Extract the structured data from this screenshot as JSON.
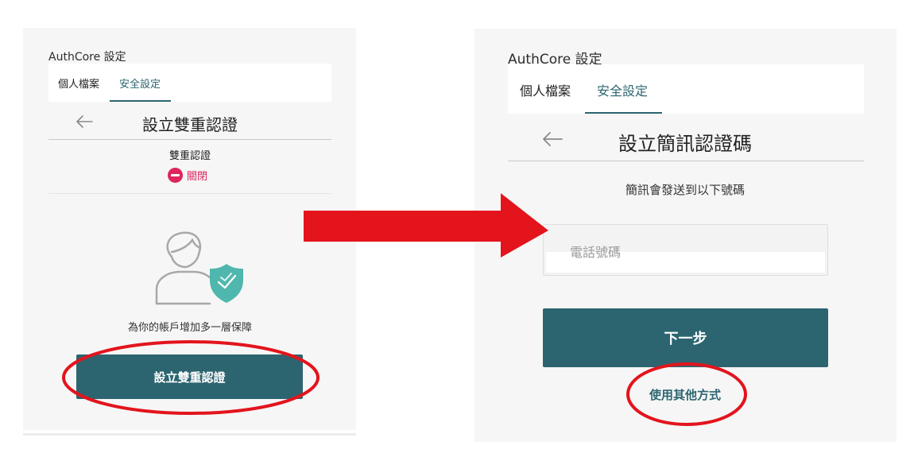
{
  "left": {
    "app_title": "AuthCore 設定",
    "tabs": [
      {
        "label": "個人檔案",
        "active": false
      },
      {
        "label": "安全設定",
        "active": true
      }
    ],
    "heading": "設立雙重認證",
    "twofa_label": "雙重認證",
    "status_text": "關閉",
    "status_color": "#e0245e",
    "tagline": "為你的帳戶增加多一層保障",
    "setup_button": "設立雙重認證"
  },
  "right": {
    "app_title": "AuthCore 設定",
    "tabs": [
      {
        "label": "個人檔案",
        "active": false
      },
      {
        "label": "安全設定",
        "active": true
      }
    ],
    "heading": "設立簡訊認證碼",
    "instruction": "簡訊會發送到以下號碼",
    "phone_placeholder": "電話號碼",
    "next_button": "下一步",
    "alt_link": "使用其他方式"
  },
  "colors": {
    "accent": "#2c6570",
    "shield": "#4fb7ad",
    "annotation_red": "#e3141c",
    "panel_bg": "#f6f6f6"
  },
  "icons": [
    "back-arrow-icon",
    "minus-circle-icon",
    "user-shield-icon",
    "arrow-right-icon"
  ]
}
